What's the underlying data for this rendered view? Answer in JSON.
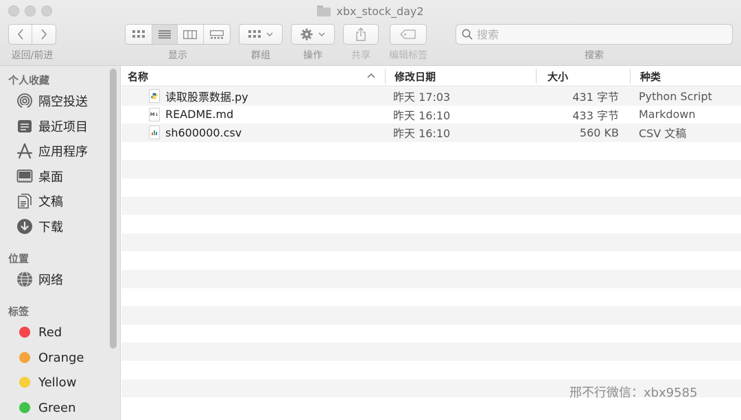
{
  "window": {
    "title": "xbx_stock_day2"
  },
  "toolbar": {
    "nav_label": "返回/前进",
    "view_label": "显示",
    "group_label": "群组",
    "action_label": "操作",
    "share_label": "共享",
    "tags_label": "编辑标签",
    "search_label": "搜索",
    "search_placeholder": "搜索"
  },
  "sidebar": {
    "favorites_heading": "个人收藏",
    "favorites": [
      {
        "label": "隔空投送",
        "icon": "airdrop-icon"
      },
      {
        "label": "最近项目",
        "icon": "recents-icon"
      },
      {
        "label": "应用程序",
        "icon": "applications-icon"
      },
      {
        "label": "桌面",
        "icon": "desktop-icon"
      },
      {
        "label": "文稿",
        "icon": "documents-icon"
      },
      {
        "label": "下载",
        "icon": "downloads-icon"
      }
    ],
    "locations_heading": "位置",
    "locations": [
      {
        "label": "网络",
        "icon": "network-icon"
      }
    ],
    "tags_heading": "标签",
    "tags": [
      {
        "label": "Red",
        "color": "#f4474c"
      },
      {
        "label": "Orange",
        "color": "#f5a43c"
      },
      {
        "label": "Yellow",
        "color": "#f7cf3d"
      },
      {
        "label": "Green",
        "color": "#3fc34d"
      }
    ]
  },
  "columns": {
    "name": "名称",
    "modified": "修改日期",
    "size": "大小",
    "kind": "种类"
  },
  "files": [
    {
      "name": "读取股票数据.py",
      "modified": "昨天 17:03",
      "size": "431 字节",
      "kind": "Python Script",
      "icon": "python-file-icon"
    },
    {
      "name": "README.md",
      "modified": "昨天 16:10",
      "size": "433 字节",
      "kind": "Markdown",
      "icon": "markdown-file-icon"
    },
    {
      "name": "sh600000.csv",
      "modified": "昨天 16:10",
      "size": "560 KB",
      "kind": "CSV 文稿",
      "icon": "csv-file-icon"
    }
  ],
  "watermark": "邢不行微信：xbx9585"
}
